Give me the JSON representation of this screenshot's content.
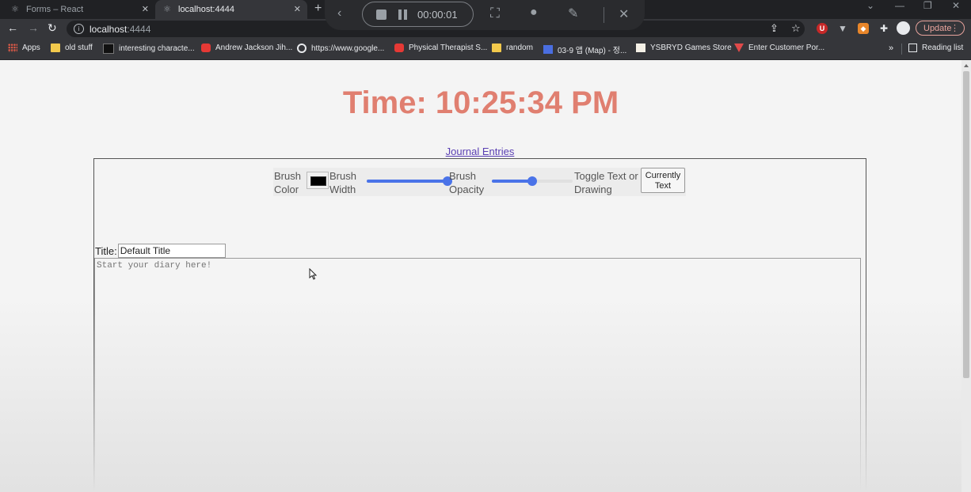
{
  "browser": {
    "tabs": [
      {
        "title": "Forms – React",
        "active": false
      },
      {
        "title": "localhost:4444",
        "active": true
      }
    ],
    "new_tab_glyph": "+",
    "address": {
      "host": "localhost",
      "port": ":4444"
    },
    "update_label": "Update",
    "recorder": {
      "timer": "00:00:01"
    },
    "bookmarks": [
      {
        "label": "Apps",
        "icon": "apps-grid"
      },
      {
        "label": "old stuff",
        "icon": "folder"
      },
      {
        "label": "interesting characte...",
        "icon": "dark-square"
      },
      {
        "label": "Andrew Jackson Jih...",
        "icon": "youtube"
      },
      {
        "label": "https://www.google...",
        "icon": "google"
      },
      {
        "label": "Physical Therapist S...",
        "icon": "youtube"
      },
      {
        "label": "random",
        "icon": "folder"
      },
      {
        "label": "03-9 앱 (Map) - 정...",
        "icon": "blue-square"
      },
      {
        "label": "YSBRYD Games Store",
        "icon": "store"
      },
      {
        "label": "Enter Customer Por...",
        "icon": "red-shield"
      }
    ],
    "overflow_glyph": "»",
    "reading_list_label": "Reading list"
  },
  "page": {
    "clock": "Time: 10:25:34 PM",
    "journal_link": "Journal Entries",
    "controls": {
      "brush_color_label": [
        "Brush",
        "Color"
      ],
      "brush_width_label": [
        "Brush",
        "Width"
      ],
      "brush_width_value": 1.0,
      "brush_opacity_label": [
        "Brush",
        "Opacity"
      ],
      "brush_opacity_value": 0.5,
      "toggle_label": [
        "Toggle Text or",
        "Drawing"
      ],
      "toggle_button": [
        "Currently",
        "Text"
      ],
      "brush_color": "#000000"
    },
    "title_label": "Title:",
    "title_value": "Default Title",
    "diary_placeholder": "Start your diary here!"
  },
  "colors": {
    "clock": "#e07f70",
    "link": "#5a3fb3",
    "slider": "#4a73e8"
  }
}
